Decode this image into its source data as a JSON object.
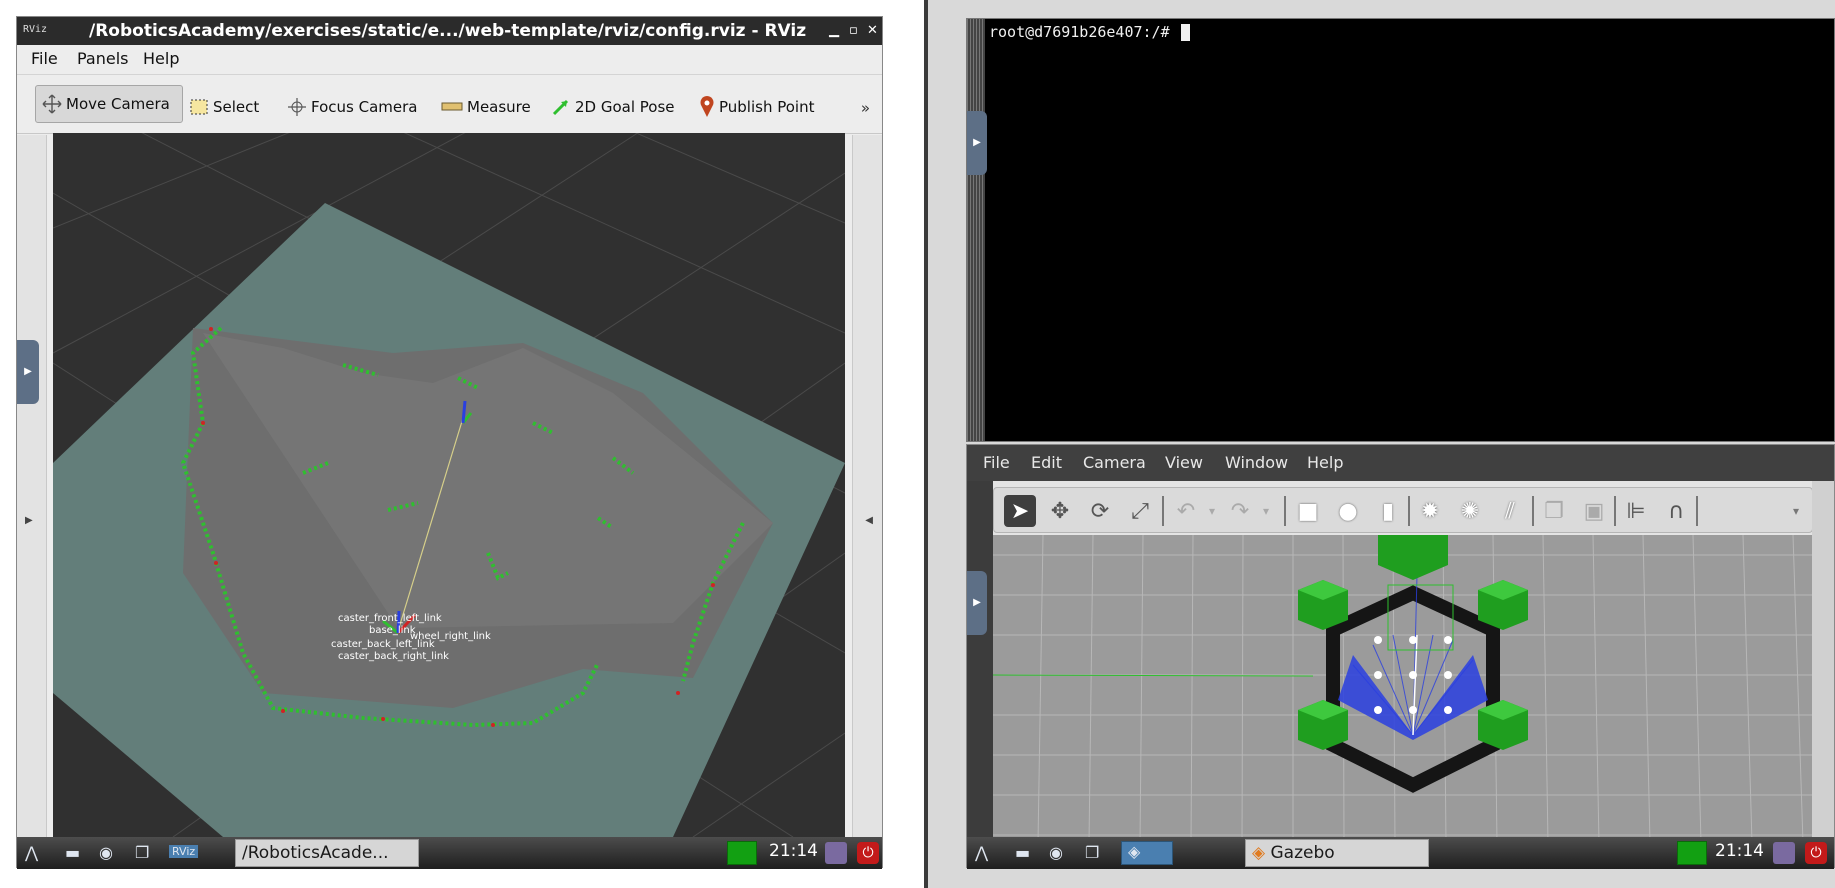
{
  "rviz": {
    "app_icon": "RViz",
    "title": "/RoboticsAcademy/exercises/static/e.../web-template/rviz/config.rviz - RViz",
    "window_buttons": [
      "minimize-icon",
      "maximize-icon",
      "close-icon"
    ],
    "menu": [
      "File",
      "Panels",
      "Help"
    ],
    "tools": [
      {
        "label": "Move Camera",
        "icon": "move-camera-icon",
        "active": true
      },
      {
        "label": "Select",
        "icon": "select-icon"
      },
      {
        "label": "Focus Camera",
        "icon": "focus-camera-icon"
      },
      {
        "label": "Measure",
        "icon": "measure-icon"
      },
      {
        "label": "2D Goal Pose",
        "icon": "goal-arrow-icon"
      },
      {
        "label": "Publish Point",
        "icon": "map-pin-icon"
      }
    ],
    "more": "»",
    "frame_labels": [
      "caster_front_left_link",
      "base_link",
      "wheel_right_link",
      "caster_back_left_link",
      "caster_back_right_link"
    ],
    "colors": {
      "grid_bg": "#303030",
      "occupied": "#2fbf2f",
      "costmap": "#6d8783",
      "free": "#7a7a7a"
    }
  },
  "taskbar_left": {
    "task_label": "/RoboticsAcade...",
    "time": "21:14"
  },
  "terminal": {
    "prompt": "root@d7691b26e407:/# "
  },
  "gazebo": {
    "menu": [
      "File",
      "Edit",
      "Camera",
      "View",
      "Window",
      "Help"
    ],
    "colors": {
      "ground": "#9b9b9b",
      "laser": "#2a3fe0",
      "robot_frame": "#1a1a1a",
      "blocks": "#1f9e1f"
    }
  },
  "taskbar_right": {
    "task_label": "Gazebo",
    "time": "21:14"
  }
}
